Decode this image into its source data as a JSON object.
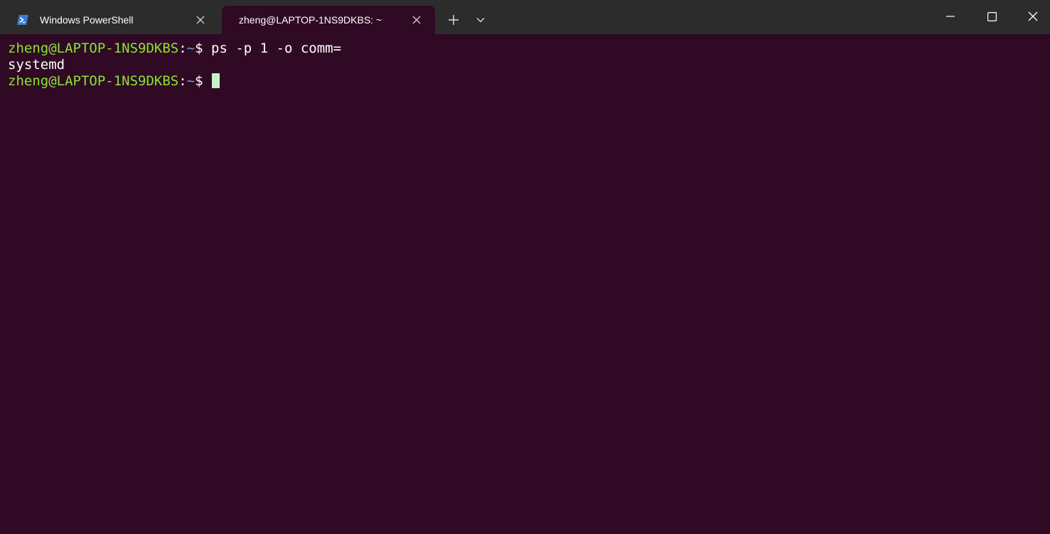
{
  "tabs": [
    {
      "label": "Windows PowerShell",
      "icon": "powershell-icon",
      "active": false
    },
    {
      "label": "zheng@LAPTOP-1NS9DKBS: ~",
      "active": true
    }
  ],
  "titlebar": {
    "new_tab_icon": "plus-icon",
    "dropdown_icon": "chevron-down-icon",
    "minimize_icon": "minimize-icon",
    "maximize_icon": "maximize-icon",
    "close_icon": "close-icon"
  },
  "terminal": {
    "background": "#300a24",
    "prompt_color": "#8ae234",
    "lines": [
      {
        "prompt_user": "zheng@LAPTOP-1NS9DKBS",
        "prompt_sep": ":",
        "prompt_path": "~",
        "prompt_end": "$ ",
        "command": "ps -p 1 -o comm="
      },
      {
        "output": "systemd"
      },
      {
        "prompt_user": "zheng@LAPTOP-1NS9DKBS",
        "prompt_sep": ":",
        "prompt_path": "~",
        "prompt_end": "$ ",
        "command": ""
      }
    ]
  }
}
